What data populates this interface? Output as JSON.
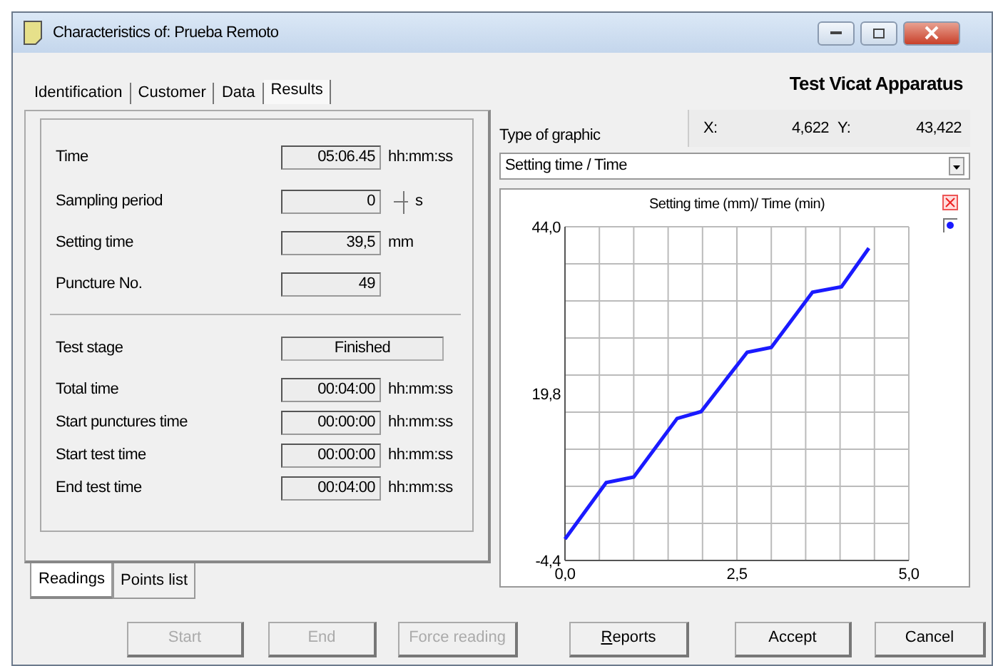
{
  "window": {
    "title": "Characteristics of: Prueba Remoto"
  },
  "tabs": [
    {
      "label": "Identification",
      "selected": false
    },
    {
      "label": "Customer",
      "selected": false
    },
    {
      "label": "Data",
      "selected": false
    },
    {
      "label": "Results",
      "selected": true
    }
  ],
  "apparatus": "Test Vicat Apparatus",
  "readings": [
    {
      "label": "Time",
      "value": "05:06.45",
      "unit": "hh:mm:ss",
      "kind": "field"
    },
    {
      "label": "Sampling period",
      "value": "0",
      "unit": "s",
      "kind": "spinner"
    },
    {
      "label": "Setting time",
      "value": "39,5",
      "unit": "mm",
      "kind": "field"
    },
    {
      "label": "Puncture No.",
      "value": "49",
      "kind": "field"
    }
  ],
  "stage": [
    {
      "label": "Test stage",
      "value": "Finished",
      "kind": "status"
    },
    {
      "label": "Total time",
      "value": "00:04:00",
      "unit": "hh:mm:ss",
      "kind": "field"
    },
    {
      "label": "Start punctures time",
      "value": "00:00:00",
      "unit": "hh:mm:ss",
      "kind": "field"
    },
    {
      "label": "Start test time",
      "value": "00:00:00",
      "unit": "hh:mm:ss",
      "kind": "field"
    },
    {
      "label": "End test time",
      "value": "00:04:00",
      "unit": "hh:mm:ss",
      "kind": "field"
    }
  ],
  "panel_tabs": [
    {
      "label": "Readings",
      "selected": true
    },
    {
      "label": "Points list",
      "selected": false
    }
  ],
  "graphic": {
    "label": "Type of graphic",
    "selection": "Setting time / Time",
    "x_label": "X:",
    "x_value": "4,622",
    "y_label": "Y:",
    "y_value": "43,422",
    "chart_data": {
      "type": "line",
      "title": "Setting time (mm)/ Time (min)",
      "xlim": [
        0,
        5
      ],
      "ylim": [
        -4.4,
        44
      ],
      "xticks": [
        {
          "value": 0,
          "label": "0,0"
        },
        {
          "value": 2.5,
          "label": "2,5"
        },
        {
          "value": 5,
          "label": "5,0"
        }
      ],
      "yticks": [
        {
          "value": -4.4,
          "label": "-4,4"
        },
        {
          "value": 19.8,
          "label": "19,8"
        },
        {
          "value": 44,
          "label": "44,0"
        }
      ],
      "x": [
        0,
        0.6,
        1.0,
        1.63,
        1.98,
        2.65,
        3.0,
        3.6,
        4.02,
        4.42
      ],
      "series": [
        {
          "color": "#1a1aff",
          "values": [
            -1.3,
            6.9,
            7.7,
            16.2,
            17.2,
            25.8,
            26.5,
            34.5,
            35.3,
            40.9
          ]
        }
      ]
    }
  },
  "buttons": [
    {
      "label": "Start",
      "disabled": true
    },
    {
      "label": "End",
      "disabled": true
    },
    {
      "label": "Force reading",
      "disabled": true
    },
    {
      "label": "Reports",
      "disabled": false
    },
    {
      "label": "Accept",
      "disabled": false
    },
    {
      "label": "Cancel",
      "disabled": false
    }
  ]
}
